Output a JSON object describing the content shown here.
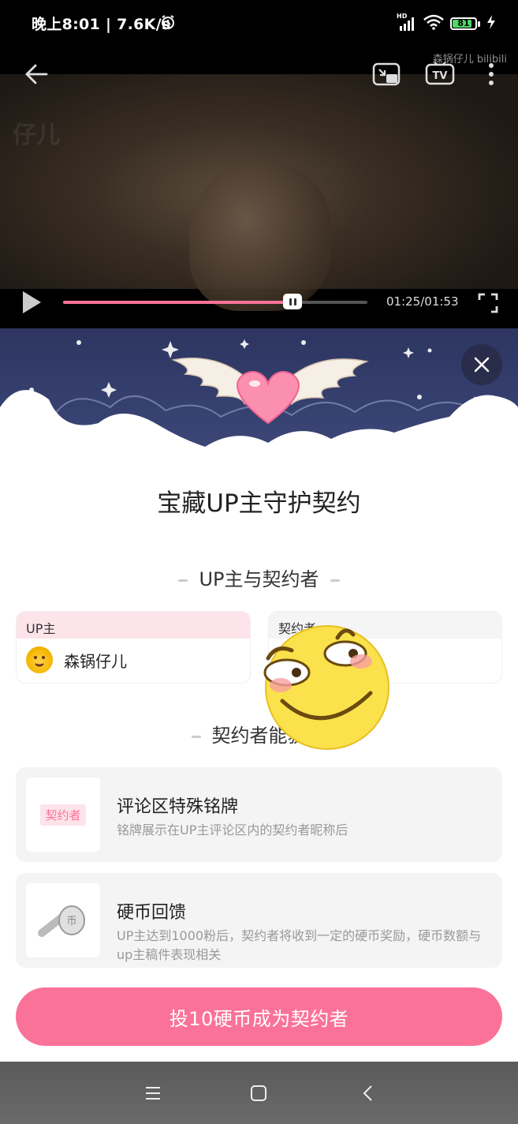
{
  "status_bar": {
    "left": "晚上8:01 | 7.6K/s",
    "signal_badge": "HD",
    "battery": "81"
  },
  "player": {
    "watermark": "森锅仔儿 bilibili",
    "frame_text": "仔儿",
    "time": "01:25/01:53",
    "progress": 0.755
  },
  "sheet": {
    "title": "宝藏UP主守护契约",
    "section1": "UP主与契约者",
    "up_card": {
      "header": "UP主",
      "name": "森锅仔儿"
    },
    "contractor_card": {
      "header": "契约者"
    },
    "section2": "契约者能获",
    "features": [
      {
        "badge": "契约者",
        "title": "评论区特殊铭牌",
        "desc": "铭牌展示在UP主评论区内的契约者昵称后"
      },
      {
        "title": "硬币回馈",
        "desc": "UP主达到1000粉后，契约者将收到一定的硬币奖励，硬币数额与up主稿件表现相关"
      }
    ],
    "cta": "投10硬币成为契约者"
  },
  "colors": {
    "accent": "#fb7299",
    "night_sky": "#2d3560"
  },
  "icons": [
    "back-arrow-icon",
    "pip-icon",
    "tv-cast-icon",
    "more-icon",
    "play-icon",
    "fullscreen-icon",
    "close-icon",
    "winged-heart-icon",
    "coin-icon",
    "emoji-sticker-icon",
    "menu-nav-icon",
    "home-nav-icon",
    "back-nav-icon"
  ]
}
